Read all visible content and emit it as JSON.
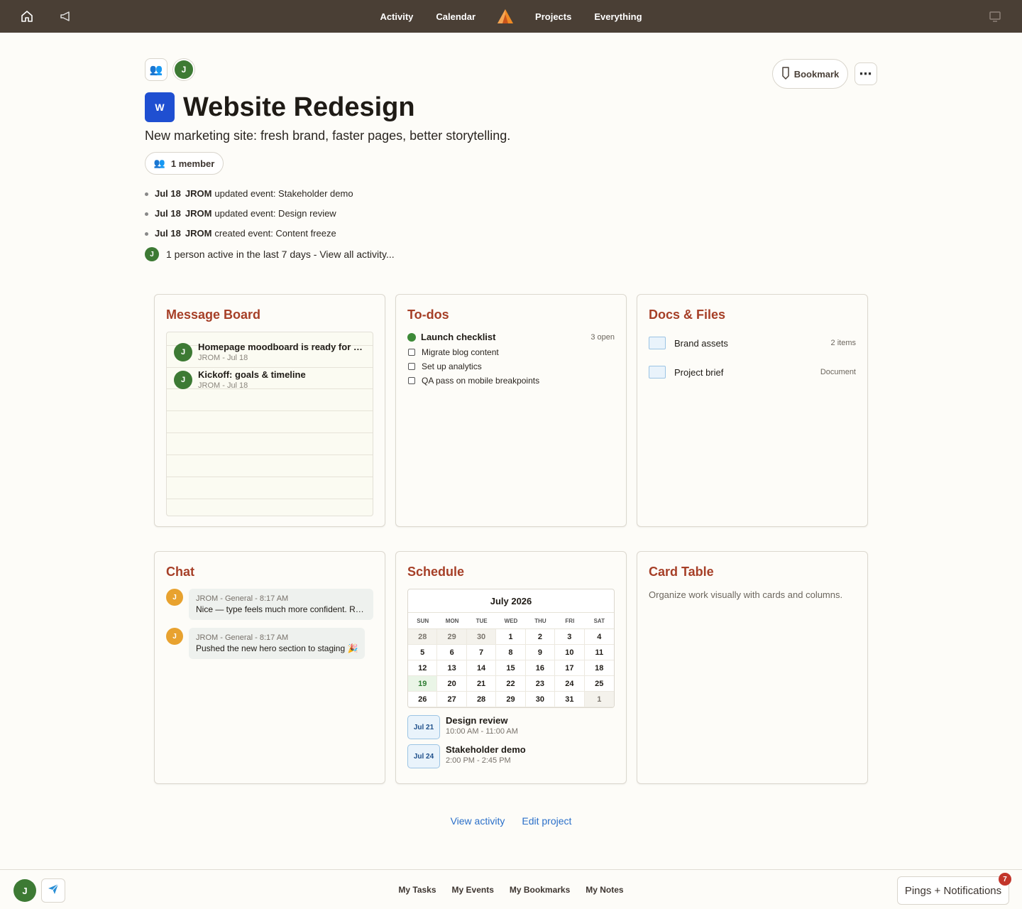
{
  "nav": {
    "links": [
      "Activity",
      "Calendar",
      "Projects",
      "Everything"
    ],
    "icons": [
      "home-icon",
      "megaphone-icon",
      "campfire-logo",
      "screen-icon"
    ]
  },
  "header": {
    "bookmark_label": "Bookmark",
    "more_label": "⋯",
    "user_initial": "J",
    "project_initial": "W",
    "title": "Website Redesign",
    "description": "New marketing site: fresh brand, faster pages, better storytelling.",
    "members_label": "1 member",
    "activity": [
      {
        "date": "Jul 18",
        "user": "JROM",
        "text": "updated event: Stakeholder demo"
      },
      {
        "date": "Jul 18",
        "user": "JROM",
        "text": "updated event: Design review"
      },
      {
        "date": "Jul 18",
        "user": "JROM",
        "text": "created event: Content freeze"
      }
    ],
    "activity_summary": "1 person active in the last 7 days - View all activity..."
  },
  "message_board": {
    "title": "Message Board",
    "messages": [
      {
        "title": "Homepage moodboard is ready for review",
        "meta": "JROM - Jul 18",
        "initial": "J"
      },
      {
        "title": "Kickoff: goals & timeline",
        "meta": "JROM - Jul 18",
        "initial": "J"
      }
    ]
  },
  "todos": {
    "title": "To-dos",
    "list_name": "Launch checklist",
    "count": "3 open",
    "items": [
      "Migrate blog content",
      "Set up analytics",
      "QA pass on mobile breakpoints"
    ]
  },
  "docs": {
    "title": "Docs & Files",
    "items": [
      {
        "name": "Brand assets",
        "meta": "2 items"
      },
      {
        "name": "Project brief",
        "meta": "Document"
      }
    ]
  },
  "chat": {
    "title": "Chat",
    "messages": [
      {
        "initial": "J",
        "meta": "JROM - General - 8:17 AM",
        "text": "Nice — type feels much more confident. Really like it."
      },
      {
        "initial": "J",
        "meta": "JROM - General - 8:17 AM",
        "text": "Pushed the new hero section to staging 🎉"
      }
    ]
  },
  "schedule": {
    "title": "Schedule",
    "month": "July 2026",
    "dows": [
      "SUN",
      "MON",
      "TUE",
      "WED",
      "THU",
      "FRI",
      "SAT"
    ],
    "days": [
      "28",
      "29",
      "30",
      "1",
      "2",
      "3",
      "4",
      "5",
      "6",
      "7",
      "8",
      "9",
      "10",
      "11",
      "12",
      "13",
      "14",
      "15",
      "16",
      "17",
      "18",
      "19",
      "20",
      "21",
      "22",
      "23",
      "24",
      "25",
      "26",
      "27",
      "28",
      "29",
      "30",
      "31",
      "1"
    ],
    "muted_days": [
      0,
      1,
      2,
      34
    ],
    "today_index": 21,
    "events": [
      {
        "date": "Jul 21",
        "title": "Design review",
        "time": "10:00 AM - 11:00 AM"
      },
      {
        "date": "Jul 24",
        "title": "Stakeholder demo",
        "time": "2:00 PM - 2:45 PM"
      }
    ]
  },
  "card_table": {
    "title": "Card Table",
    "description": "Organize work visually with cards and columns."
  },
  "footer": {
    "view_activity": "View activity",
    "edit_project": "Edit project"
  },
  "bottombar": {
    "user_initial": "J",
    "links": [
      "My Tasks",
      "My Events",
      "My Bookmarks",
      "My Notes"
    ],
    "pings_label": "Pings + Notifications",
    "pings_count": "7"
  },
  "colors": {
    "nav_bg": "#4a3f35",
    "card_title": "#a63f27",
    "avatar_green": "#3d7a34",
    "avatar_orange": "#e8a22f",
    "project_badge": "#1f4fd1",
    "link": "#2a6fc9"
  }
}
